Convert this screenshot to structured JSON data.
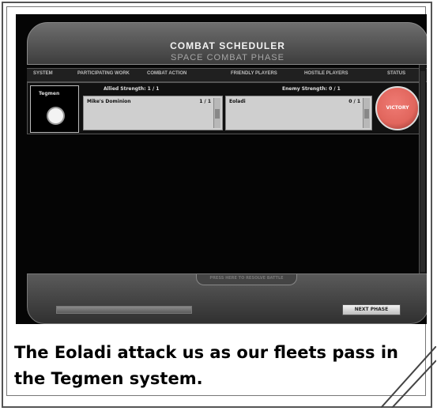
{
  "scheduler": {
    "title": "COMBAT SCHEDULER",
    "subtitle": "SPACE COMBAT PHASE",
    "columns": [
      "SYSTEM",
      "PARTICIPATING WORK",
      "COMBAT ACTION",
      "FRIENDLY PLAYERS",
      "HOSTILE PLAYERS",
      "STATUS"
    ],
    "system": {
      "name": "Tegmen"
    },
    "allied": {
      "label": "Allied Strength: 1 / 1",
      "entries": [
        {
          "name": "Mike's Dominion",
          "count": "1 / 1"
        }
      ]
    },
    "enemy": {
      "label": "Enemy Strength: 0 / 1",
      "entries": [
        {
          "name": "Eoladi",
          "count": "0 / 1"
        }
      ]
    },
    "status": {
      "label": "VICTORY",
      "color": "#e1665d"
    },
    "footer": {
      "middle_tab": "PRESS HERE TO RESOLVE BATTLE",
      "next_button": "NEXT PHASE",
      "progress": 1
    }
  },
  "caption": "The Eoladi attack us as our fleets pass in the Tegmen system."
}
